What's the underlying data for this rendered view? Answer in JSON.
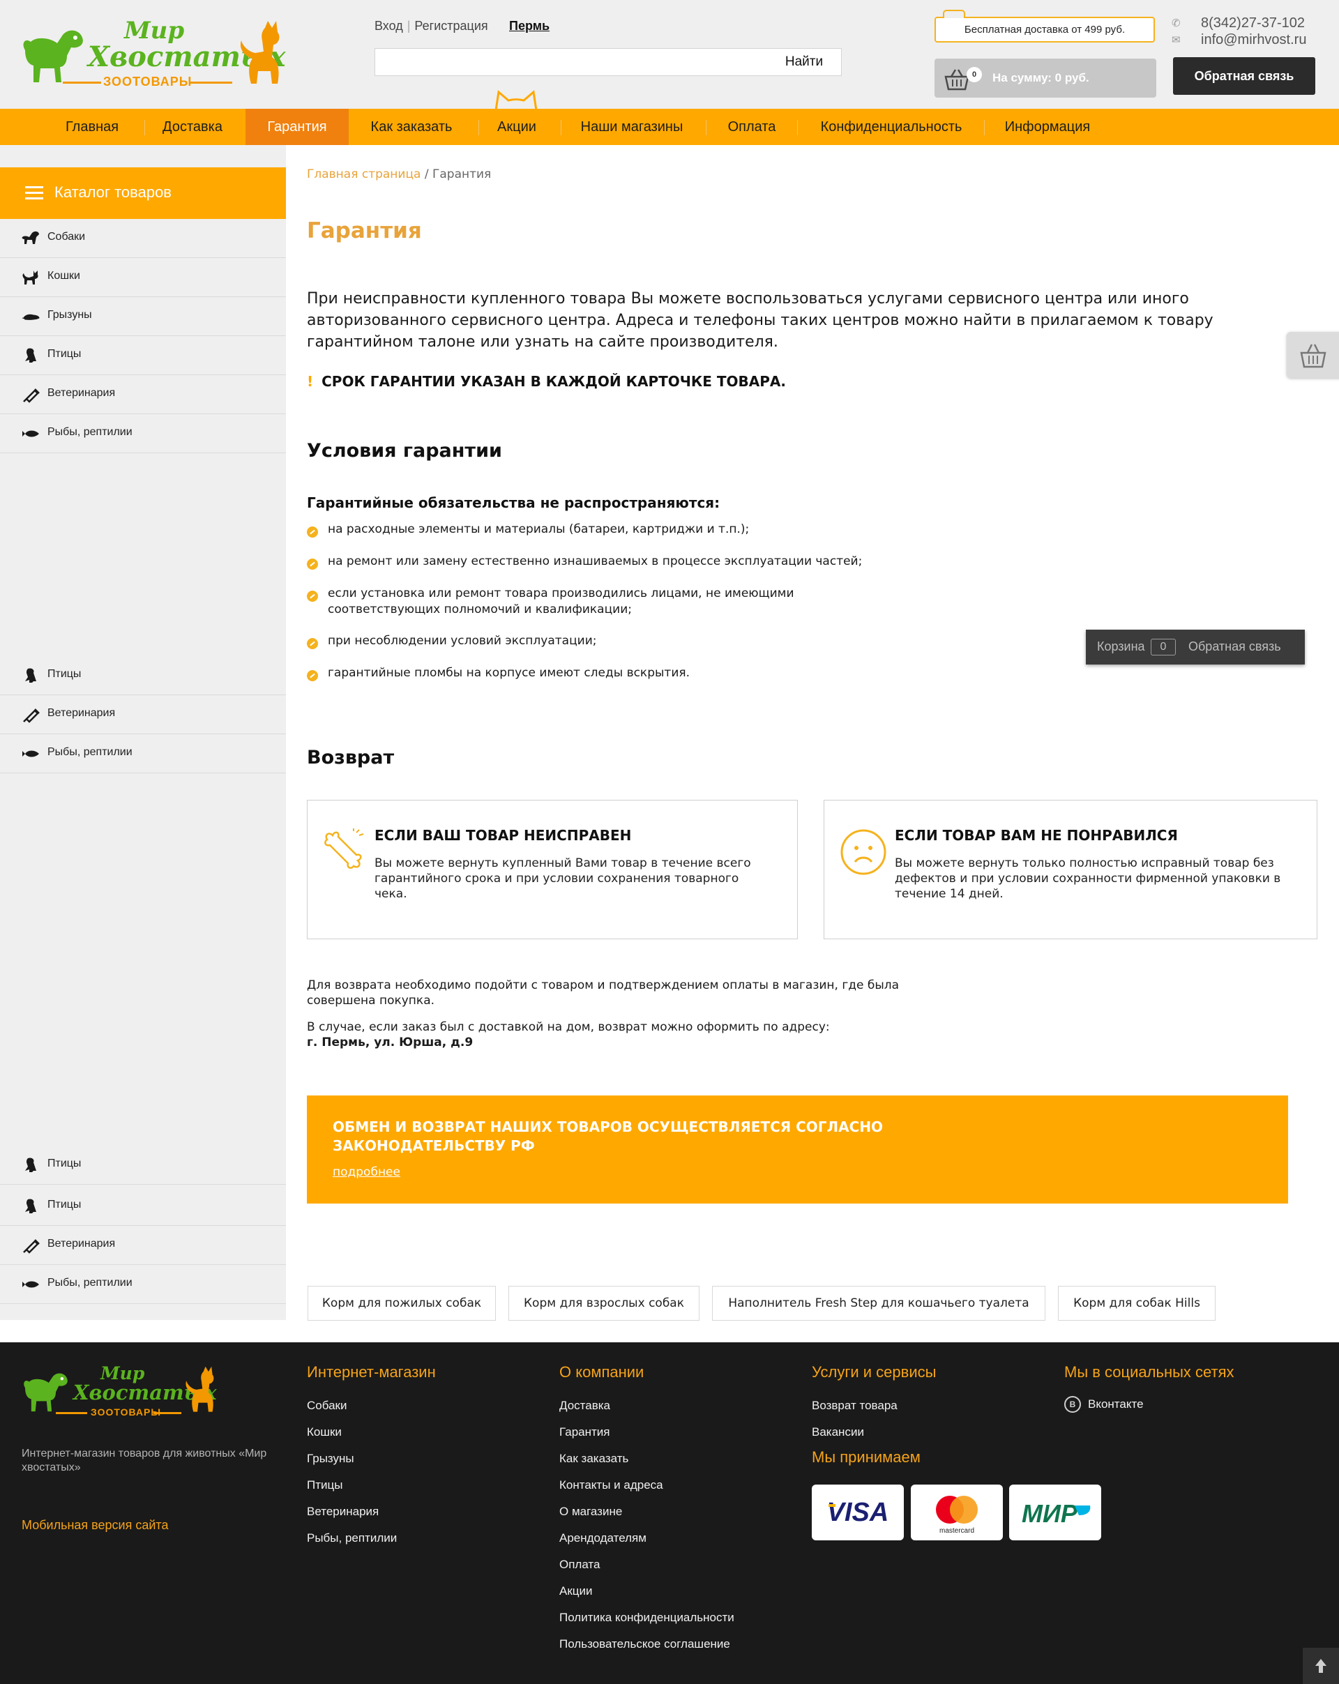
{
  "header": {
    "logo": {
      "line1": "Мир",
      "line2": "Хвостатых",
      "line3": "ЗООТОВАРЫ"
    },
    "login": "Вход",
    "register": "Регистрация",
    "city": "Пермь",
    "search": {
      "placeholder": "",
      "button": "Найти"
    },
    "free_shipping": "Бесплатная доставка от 499 руб.",
    "cart": {
      "count": "0",
      "sum": "На сумму: 0 руб."
    },
    "phone": "8(342)27-37-102",
    "email": "info@mirhvost.ru",
    "feedback": "Обратная связь"
  },
  "nav": [
    {
      "label": "Главная"
    },
    {
      "label": "Доставка"
    },
    {
      "label": "Гарантия",
      "active": true
    },
    {
      "label": "Как заказать"
    },
    {
      "label": "Акции"
    },
    {
      "label": "Наши магазины"
    },
    {
      "label": "Оплата"
    },
    {
      "label": "Конфиденциальность"
    },
    {
      "label": "Информация"
    }
  ],
  "sidebar": {
    "title": "Каталог товаров",
    "items": [
      {
        "label": "Собаки",
        "icon": "dog-icon"
      },
      {
        "label": "Кошки",
        "icon": "cat-icon"
      },
      {
        "label": "Грызуны",
        "icon": "rodent-icon"
      },
      {
        "label": "Птицы",
        "icon": "bird-icon"
      },
      {
        "label": "Ветеринария",
        "icon": "syringe-icon"
      },
      {
        "label": "Рыбы, рептилии",
        "icon": "fish-icon"
      }
    ],
    "repeat_1": [
      {
        "label": "Птицы",
        "icon": "bird-icon"
      },
      {
        "label": "Ветеринария",
        "icon": "syringe-icon"
      },
      {
        "label": "Рыбы, рептилии",
        "icon": "fish-icon"
      }
    ],
    "repeat_2": [
      {
        "label": "Птицы",
        "icon": "bird-icon"
      },
      {
        "label": "Птицы",
        "icon": "bird-icon"
      },
      {
        "label": "Ветеринария",
        "icon": "syringe-icon"
      },
      {
        "label": "Рыбы, рептилии",
        "icon": "fish-icon"
      }
    ]
  },
  "content": {
    "breadcrumbs": {
      "home": "Главная страница",
      "separator": " / ",
      "current": "Гарантия"
    },
    "title": "Гарантия",
    "intro": "При неисправности купленного товара Вы можете воспользоваться услугами сервисного центра или иного авторизованного сервисного центра. Адреса и телефоны таких центров можно найти в прилагаемом к товару гарантийном талоне или узнать на сайте производителя.",
    "note_mark": "!",
    "note": "СРОК ГАРАНТИИ УКАЗАН В КАЖДОЙ КАРТОЧКЕ ТОВАРА.",
    "conditions_title": "Условия гарантии",
    "not_covered_title": "Гарантийные обязательства не распространяются:",
    "not_covered": [
      "на расходные элементы и материалы (батареи, картриджи и т.п.);",
      "на ремонт или замену естественно изнашиваемых в процессе эксплуатации частей;",
      "если установка или ремонт товара производились лицами, не имеющими соответствующих полномочий и квалификации;",
      "при несоблюдении условий эксплуатации;",
      "гарантийные пломбы на корпусе имеют следы вскрытия."
    ],
    "return_title": "Возврат",
    "cards": [
      {
        "icon": "bone-icon",
        "title": "ЕСЛИ ВАШ ТОВАР НЕИСПРАВЕН",
        "text": "Вы можете вернуть купленный Вами товар в течение всего гарантийного срока и при условии сохранения товарного чека."
      },
      {
        "icon": "sad-face-icon",
        "title": "ЕСЛИ ТОВАР ВАМ НЕ ПОНРАВИЛСЯ",
        "text": "Вы можете вернуть только полностью исправный товар без дефектов и при условии сохранности фирменной упаковки в течение 14 дней."
      }
    ],
    "return_info_1": "Для возврата необходимо подойти с товаром и подтверждением оплаты в магазин, где была совершена покупка.",
    "return_info_2": "В случае, если заказ был с доставкой на дом, возврат можно оформить по адресу:",
    "return_address": "г. Пермь, ул. Юрша, д.9",
    "banner": {
      "title": "ОБМЕН И ВОЗВРАТ НАШИХ ТОВАРОВ ОСУЩЕСТВЛЯЕТСЯ СОГЛАСНО ЗАКОНОДАТЕЛЬСТВУ РФ",
      "link": "подробнее"
    },
    "tags": [
      "Корм для пожилых собак",
      "Корм для взрослых собак",
      "Наполнитель Fresh Step для кошачьего туалета",
      "Корм для собак Hills"
    ]
  },
  "floating": {
    "cart_label": "Корзина",
    "cart_count": "0",
    "feedback": "Обратная связь"
  },
  "footer": {
    "description": "Интернет-магазин товаров для животных «Мир хвостатых»",
    "mobile": "Мобильная версия сайта",
    "columns": [
      {
        "title": "Интернет-магазин",
        "links": [
          "Собаки",
          "Кошки",
          "Грызуны",
          "Птицы",
          "Ветеринария",
          "Рыбы, рептилии"
        ]
      },
      {
        "title": "О компании",
        "links": [
          "Доставка",
          "Гарантия",
          "Как заказать",
          "Контакты и адреса",
          "О магазине",
          "Арендодателям",
          "Оплата",
          "Акции",
          "Политика конфиденциальности",
          "Пользовательское соглашение"
        ]
      },
      {
        "title": "Услуги и сервисы",
        "links": [
          "Возврат товара",
          "Вакансии"
        ]
      }
    ],
    "social_title": "Мы в социальных сетях",
    "vk": "Вконтакте",
    "accept_title": "Мы принимаем",
    "payments": [
      "VISA",
      "mastercard",
      "МИР"
    ]
  },
  "colors": {
    "accent": "#ffa800",
    "accent_dark": "#f0810e",
    "title": "#e8a33a",
    "footer_bg": "#1a1a1a",
    "logo_green": "#5bb31f"
  }
}
